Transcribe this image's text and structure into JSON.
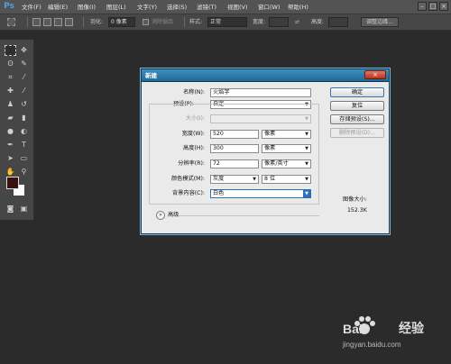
{
  "app": {
    "logo": "Ps"
  },
  "menu": [
    "文件(F)",
    "编辑(E)",
    "图像(I)",
    "图层(L)",
    "文字(Y)",
    "选择(S)",
    "滤镜(T)",
    "视图(V)",
    "窗口(W)",
    "帮助(H)"
  ],
  "window_controls": {
    "minimize": "–",
    "maximize": "□",
    "close": "×"
  },
  "options": {
    "feather_label": "羽化:",
    "feather_value": "0 像素",
    "antialias_label": "消除锯齿",
    "style_label": "样式:",
    "style_value": "正常",
    "width_label": "宽度:",
    "height_label": "高度:",
    "refine_edge_button": "调整边缘..."
  },
  "dialog": {
    "title": "新建",
    "close": "×",
    "name_label": "名称(N):",
    "name_value": "火焰字",
    "preset_label": "预设(P):",
    "preset_value": "自定",
    "size_label": "大小(I):",
    "size_value": "",
    "width_label": "宽度(W):",
    "width_value": "520",
    "width_unit": "像素",
    "height_label": "高度(H):",
    "height_value": "300",
    "height_unit": "像素",
    "resolution_label": "分辨率(R):",
    "resolution_value": "72",
    "resolution_unit": "像素/英寸",
    "color_mode_label": "颜色模式(M):",
    "color_mode_value": "灰度",
    "bit_depth_value": "8 位",
    "background_label": "背景内容(C):",
    "background_value": "白色",
    "advanced_label": "高级",
    "buttons": {
      "ok": "确定",
      "reset": "复位",
      "save_preset": "存储预设(S)...",
      "delete_preset": "删除预设(D)..."
    },
    "image_size_label": "图像大小:",
    "image_size_value": "152.3K"
  },
  "watermark": {
    "brand": "Bai",
    "suffix": "经验",
    "url": "jingyan.baidu.com"
  },
  "colors": {
    "foreground": "#3a1010",
    "background": "#ffffff",
    "title_bar": "#1e6a97"
  }
}
